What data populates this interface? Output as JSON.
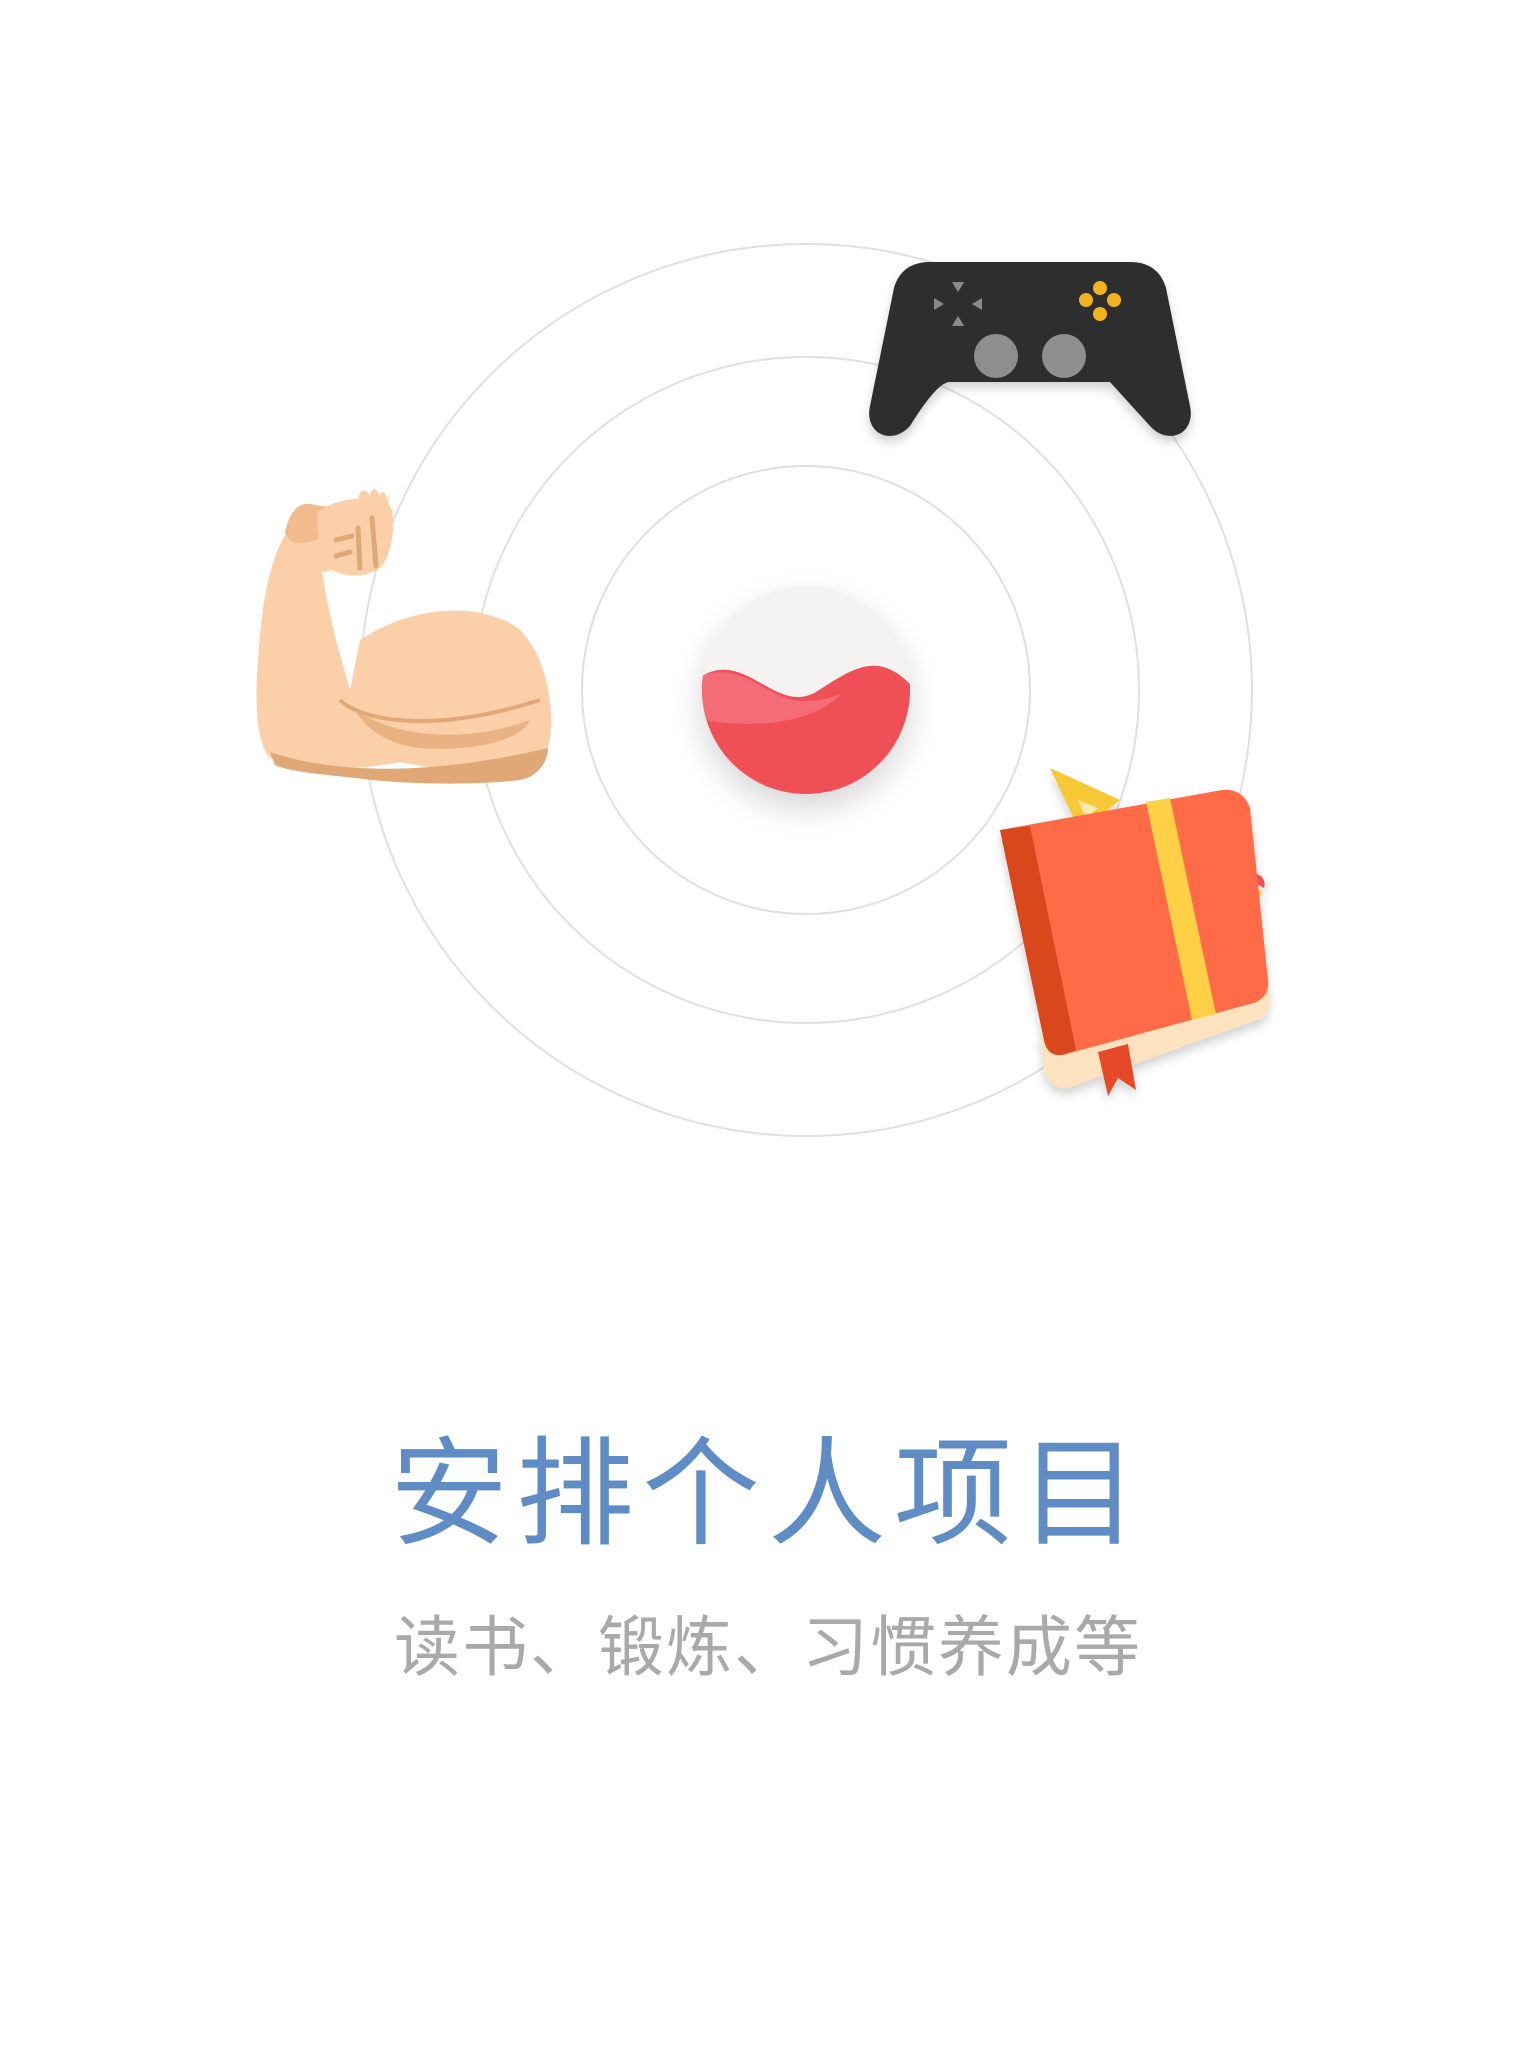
{
  "onboarding": {
    "title": "安排个人项目",
    "subtitle": "读书、锻炼、习惯养成等"
  },
  "illustration": {
    "icons": [
      "app-logo-icon",
      "gamepad-icon",
      "flexed-arm-icon",
      "notebook-icon"
    ],
    "colors": {
      "title": "#5f8cc4",
      "subtitle": "#a9a9a9",
      "rings": "#e0e0e0",
      "logo_red": "#ef4f57",
      "logo_pink": "#f4707a",
      "gamepad_body": "#2e2e2e",
      "gamepad_yellow": "#f2b21b",
      "arm_skin": "#fbd0a9",
      "arm_shadow": "#e0a777",
      "book_cover": "#ff6b47",
      "book_spine": "#d9461f",
      "book_band": "#ffd044",
      "book_pages": "#fde2c0"
    }
  }
}
